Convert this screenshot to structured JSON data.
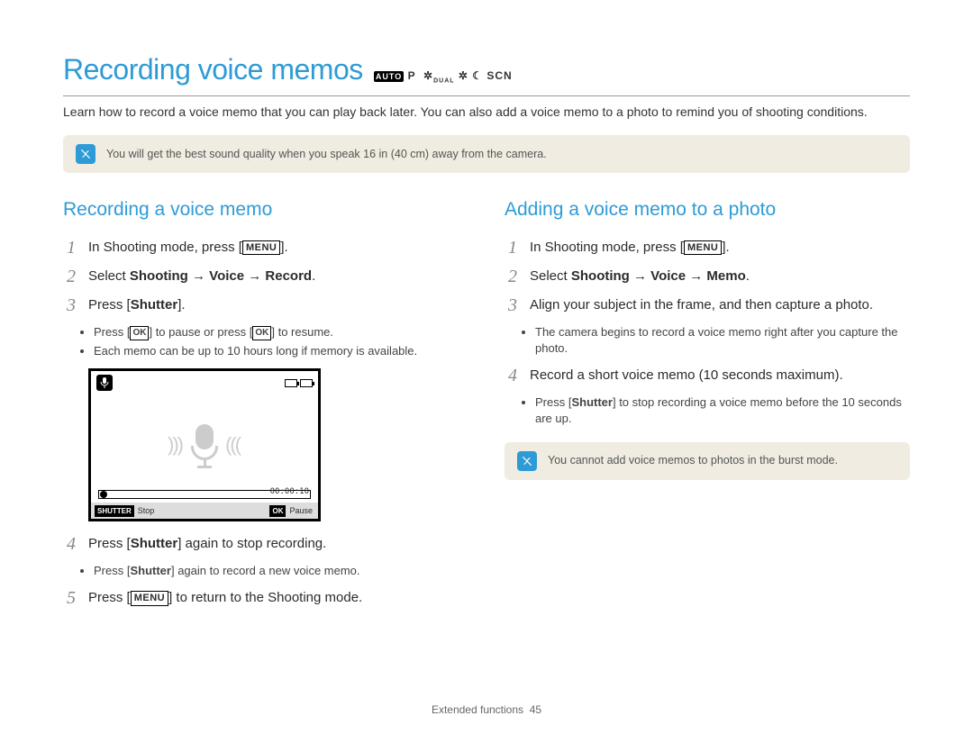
{
  "header": {
    "title": "Recording voice memos",
    "modes": "AUTO  P  DUAL  SCN"
  },
  "intro": "Learn how to record a voice memo that you can play back later. You can also add a voice memo to a photo to remind you of shooting conditions.",
  "tip": "You will get the best sound quality when you speak 16 in (40 cm) away from the camera.",
  "left": {
    "title": "Recording a voice memo",
    "steps": {
      "s1_pre": "In Shooting mode, press [",
      "s1_menu": "MENU",
      "s1_post": "].",
      "s2_pre": "Select ",
      "s2_path": "Shooting → Voice → Record",
      "s2_post": ".",
      "s3_pre": "Press [",
      "s3_key": "Shutter",
      "s3_post": "].",
      "s3_b1_pre": "Press [",
      "s3_b1_ok1": "OK",
      "s3_b1_mid": "] to pause or press [",
      "s3_b1_ok2": "OK",
      "s3_b1_post": "] to resume.",
      "s3_b2": "Each memo can be up to 10 hours long if memory is available.",
      "s4_pre": "Press [",
      "s4_key": "Shutter",
      "s4_post": "] again to stop recording.",
      "s4_b1_pre": "Press [",
      "s4_b1_key": "Shutter",
      "s4_b1_post": "] again to record a new voice memo.",
      "s5_pre": "Press [",
      "s5_menu": "MENU",
      "s5_post": "] to return to the Shooting mode."
    },
    "screen": {
      "time": "00:00:10",
      "shutter_tag": "SHUTTER",
      "stop": "Stop",
      "ok_tag": "OK",
      "pause": "Pause"
    }
  },
  "right": {
    "title": "Adding a voice memo to a photo",
    "steps": {
      "s1_pre": "In Shooting mode, press [",
      "s1_menu": "MENU",
      "s1_post": "].",
      "s2_pre": "Select ",
      "s2_path": "Shooting → Voice → Memo",
      "s2_post": ".",
      "s3": "Align your subject in the frame, and then capture a photo.",
      "s3_b1": "The camera begins to record a voice memo right after you capture the photo.",
      "s4": "Record a short voice memo (10 seconds maximum).",
      "s4_b1_pre": "Press [",
      "s4_b1_key": "Shutter",
      "s4_b1_post": "] to stop recording a voice memo before the 10 seconds are up."
    },
    "note": "You cannot add voice memos to photos in the burst mode."
  },
  "footer": {
    "section": "Extended functions",
    "page": "45"
  }
}
